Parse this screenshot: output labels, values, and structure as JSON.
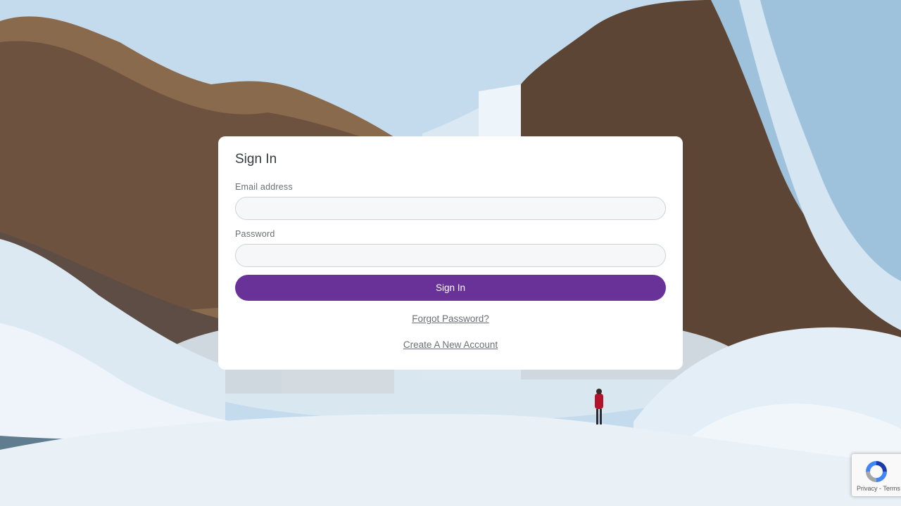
{
  "form": {
    "title": "Sign In",
    "email_label": "Email address",
    "email_value": "",
    "password_label": "Password",
    "password_value": "",
    "submit_label": "Sign In",
    "forgot_link": "Forgot Password?",
    "create_link": "Create A New Account"
  },
  "recaptcha": {
    "terms": "Privacy - Terms",
    "icon": "recaptcha-icon"
  },
  "colors": {
    "primary_button": "#693299",
    "card_background": "#ffffff"
  },
  "background": {
    "scene": "frozen-waterfall-photo"
  }
}
